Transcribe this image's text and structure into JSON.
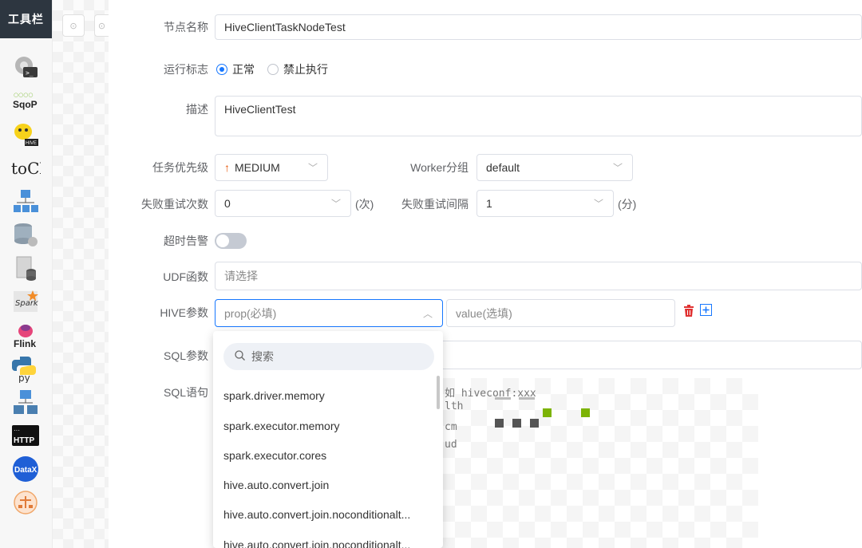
{
  "toolbar": {
    "title": "工具栏",
    "tools": [
      {
        "name": "shell-tool-icon",
        "label": ""
      },
      {
        "name": "sqoop-tool-icon",
        "label": "SqoP"
      },
      {
        "name": "hive-tool-icon",
        "label": "HIVE"
      },
      {
        "name": "tock-tool-icon",
        "label": "toCk"
      },
      {
        "name": "sub-process-tool-icon",
        "label": ""
      },
      {
        "name": "procedure-tool-icon",
        "label": ""
      },
      {
        "name": "sql-tool-icon",
        "label": ""
      },
      {
        "name": "spark-tool-icon",
        "label": "Spark"
      },
      {
        "name": "flink-tool-icon",
        "label": "Flink"
      },
      {
        "name": "python-tool-icon",
        "label": "py"
      },
      {
        "name": "dependent-tool-icon",
        "label": ""
      },
      {
        "name": "http-tool-icon",
        "label": "HTTP"
      },
      {
        "name": "datax-tool-icon",
        "label": "DataX"
      },
      {
        "name": "conditions-tool-icon",
        "label": ""
      }
    ]
  },
  "form": {
    "node_name": {
      "label": "节点名称",
      "value": "HiveClientTaskNodeTest"
    },
    "run_flag": {
      "label": "运行标志",
      "options": [
        "正常",
        "禁止执行"
      ],
      "selected": "正常"
    },
    "description": {
      "label": "描述",
      "value": "HiveClientTest"
    },
    "priority": {
      "label": "任务优先级",
      "value": "MEDIUM",
      "arrow": "↑"
    },
    "worker_group": {
      "label": "Worker分组",
      "value": "default"
    },
    "retry_times": {
      "label": "失败重试次数",
      "value": "0",
      "unit": "(次)"
    },
    "retry_interval": {
      "label": "失败重试间隔",
      "value": "1",
      "unit": "(分)"
    },
    "timeout_alarm": {
      "label": "超时告警",
      "enabled": false
    },
    "udf": {
      "label": "UDF函数",
      "placeholder": "请选择"
    },
    "hive_params": {
      "label": "HIVE参数",
      "prop_placeholder": "prop(必填)",
      "value_placeholder": "value(选填)"
    },
    "sql_params": {
      "label": "SQL参数"
    },
    "sql": {
      "label": "SQL语句",
      "lines": [
        "如 hiveconf:xxx",
        "lth",
        "cm",
        "ud"
      ]
    }
  },
  "dropdown": {
    "search_placeholder": "搜索",
    "items": [
      "spark.driver.memory",
      "spark.executor.memory",
      "spark.executor.cores",
      "hive.auto.convert.join",
      "hive.auto.convert.join.noconditionalt...",
      "hive.auto.convert.join.noconditionalt..."
    ]
  },
  "colors": {
    "primary": "#1677ff",
    "priority_arrow": "#e8590c",
    "delete": "#e03131",
    "toolbar_header": "#2d3640"
  }
}
